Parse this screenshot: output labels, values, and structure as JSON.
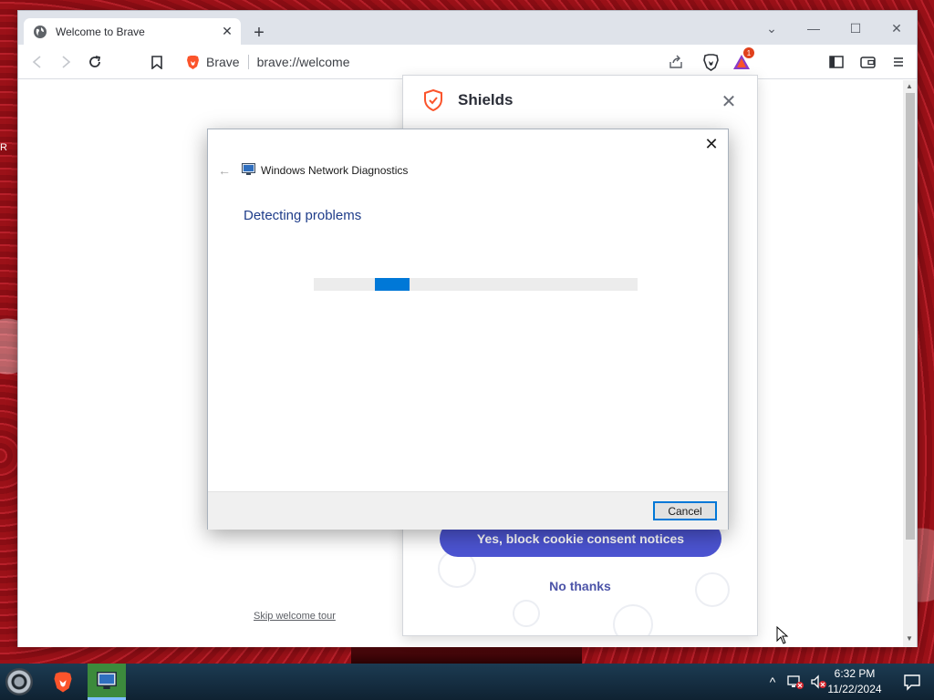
{
  "desktop": {
    "fragment_text": "R"
  },
  "browser": {
    "tab": {
      "title": "Welcome to Brave",
      "close_glyph": "✕"
    },
    "new_tab_glyph": "+",
    "window_controls": {
      "menu": "⌄",
      "minimize": "—",
      "maximize": "☐",
      "close": "✕"
    },
    "omnibox": {
      "site_label": "Brave",
      "url": "brave://welcome"
    },
    "notification_badge": "1",
    "skip_tour_label": "Skip welcome tour"
  },
  "shields": {
    "title": "Shields",
    "close_glyph": "✕",
    "block_button_label": "Yes, block cookie consent notices",
    "no_thanks_label": "No thanks"
  },
  "dialog": {
    "close_glyph": "✕",
    "back_glyph": "←",
    "title": "Windows Network Diagnostics",
    "heading": "Detecting problems",
    "progress_indeterminate": true,
    "cancel_label": "Cancel"
  },
  "taskbar": {
    "time": "6:32 PM",
    "date": "11/22/2024",
    "tray_expand_glyph": "^"
  },
  "colors": {
    "brave_orange": "#fb542b",
    "shields_button": "#4c54d2",
    "progress_blue": "#0078d7",
    "dialog_heading": "#1f3d8a"
  }
}
